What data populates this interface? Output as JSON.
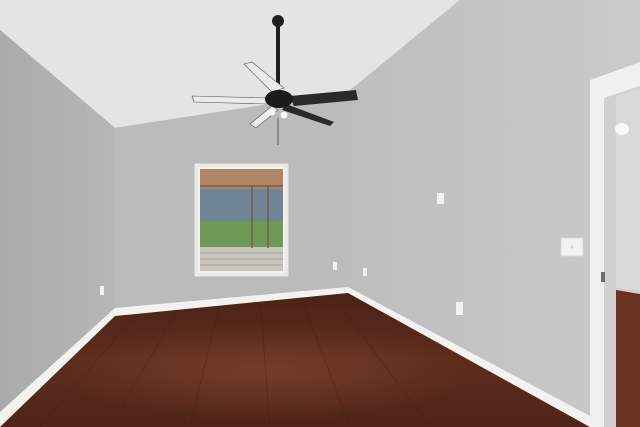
{
  "scene": {
    "subject": "empty room",
    "colors": {
      "ceiling": "#e6e6e4",
      "wall_left": "#b2b3b2",
      "wall_back": "#bbbcbb",
      "wall_right": "#c2c3c2",
      "floor": "#5a2a1c",
      "baseboard": "#f4f4f2",
      "trim": "#ededeb",
      "fan": "#1f1f1f",
      "fan_blade_light": "#e8e8e6"
    },
    "icons": [
      "ceiling-fan-icon",
      "window-icon",
      "light-switch-icon",
      "electrical-outlet-icon",
      "doorway-icon",
      "wall-sconce-icon"
    ]
  }
}
